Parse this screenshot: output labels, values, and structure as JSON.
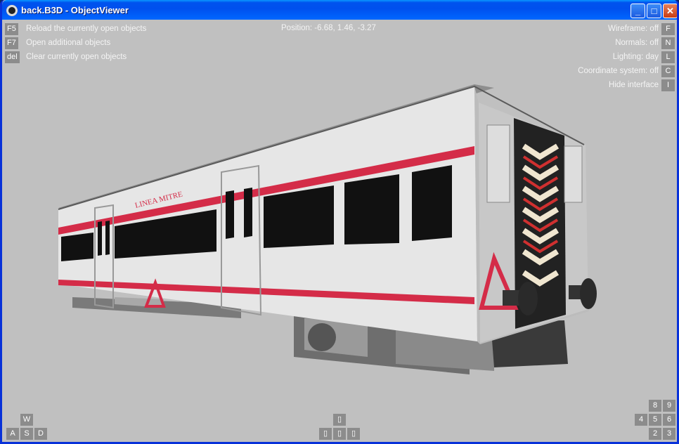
{
  "window": {
    "title": "back.B3D - ObjectViewer"
  },
  "hud": {
    "position_text": "Position: -6.68, 1.46, -3.27",
    "left_commands": [
      {
        "key": "F5",
        "label": "Reload the currently open objects"
      },
      {
        "key": "F7",
        "label": "Open additional objects"
      },
      {
        "key": "del",
        "label": "Clear currently open objects"
      }
    ],
    "right_options": [
      {
        "label": "Wireframe: off",
        "key": "F"
      },
      {
        "label": "Normals: off",
        "key": "N"
      },
      {
        "label": "Lighting: day",
        "key": "L"
      },
      {
        "label": "Coordinate system: off",
        "key": "C"
      },
      {
        "label": "Hide interface",
        "key": "I"
      }
    ],
    "move_keys": {
      "w": "W",
      "a": "A",
      "s": "S",
      "d": "D"
    },
    "arrow_keys": {
      "up": "▯",
      "left": "▯",
      "down": "▯",
      "right": "▯"
    },
    "numpad_keys": {
      "k8": "8",
      "k9": "9",
      "k4": "4",
      "k5": "5",
      "k6": "6",
      "k2": "2",
      "k3": "3"
    }
  },
  "model": {
    "car_lettering": "LINEA MITRE",
    "colors": {
      "body": "#e4e4e4",
      "stripe": "#d8304a",
      "roof": "#8a8a8a",
      "window": "#101010",
      "background": "#c0c0c0"
    }
  }
}
